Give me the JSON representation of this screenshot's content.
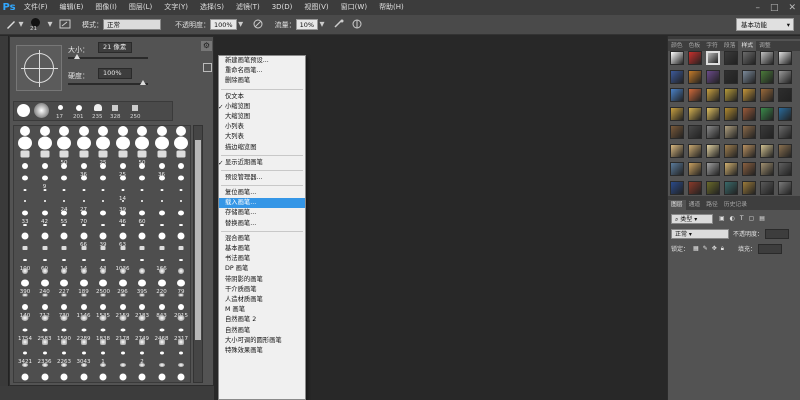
{
  "app": {
    "logo": "Ps",
    "menu": [
      "文件(F)",
      "编辑(E)",
      "图像(I)",
      "图层(L)",
      "文字(Y)",
      "选择(S)",
      "滤镜(T)",
      "3D(D)",
      "视图(V)",
      "窗口(W)",
      "帮助(H)"
    ],
    "window_controls": [
      "–",
      "□",
      "✕"
    ]
  },
  "options_bar": {
    "brush_size_value": "21",
    "mode_label": "模式：",
    "mode_value": "正常",
    "opacity_label": "不透明度：",
    "opacity_value": "100%",
    "flow_label": "流量：",
    "flow_value": "10%",
    "workspace": "基本功能"
  },
  "brush_panel": {
    "size_label": "大小：",
    "size_value": "21 像素",
    "hardness_label": "硬度：",
    "hardness_value": "100%",
    "recent_numbers": [
      "17",
      "201",
      "235",
      "328",
      "250"
    ],
    "grid_numbers": [
      [
        "",
        "",
        "",
        "",
        "",
        "",
        "",
        "",
        ""
      ],
      [
        "",
        "",
        "",
        "",
        "",
        "",
        "",
        "",
        ""
      ],
      [
        "",
        "",
        "50",
        "",
        "25",
        "",
        "50",
        "",
        ""
      ],
      [
        "",
        "",
        "",
        "36",
        "",
        "25",
        "",
        "36",
        ""
      ],
      [
        "",
        "9",
        "",
        "",
        "",
        "",
        "",
        "",
        ""
      ],
      [
        "",
        "",
        "",
        "",
        "",
        "14",
        "",
        "",
        ""
      ],
      [
        "",
        "",
        "24",
        "27",
        "",
        "39",
        "",
        "",
        ""
      ],
      [
        "33",
        "42",
        "55",
        "70",
        "",
        "46",
        "60",
        "",
        ""
      ],
      [
        "",
        "",
        "",
        "",
        "",
        "",
        "",
        "",
        ""
      ],
      [
        "",
        "",
        "",
        "66",
        "39",
        "63",
        "",
        "",
        ""
      ],
      [
        "",
        "",
        "",
        "",
        "",
        "",
        "",
        "",
        ""
      ],
      [
        "100",
        "60",
        "14",
        "14",
        "43",
        "1036",
        "",
        "166",
        ""
      ],
      [
        "",
        "",
        "",
        "",
        "",
        "",
        "",
        "",
        ""
      ],
      [
        "390",
        "240",
        "227",
        "189",
        "2500",
        "296",
        "395",
        "220",
        "79"
      ],
      [
        "",
        "",
        "",
        "",
        "",
        "",
        "",
        "",
        ""
      ],
      [
        "140",
        "712",
        "730",
        "1146",
        "1535",
        "2159",
        "2183",
        "843",
        "2015"
      ],
      [
        "",
        "",
        "",
        "",
        "",
        "",
        "",
        "",
        ""
      ],
      [
        "1754",
        "2583",
        "1590",
        "2289",
        "1838",
        "2178",
        "2749",
        "2468",
        "2317"
      ],
      [
        "",
        "",
        "",
        "",
        "",
        "",
        "",
        "",
        ""
      ],
      [
        "3421",
        "2336",
        "2263",
        "3043",
        "1",
        "",
        "2",
        "",
        ""
      ],
      [
        "",
        "",
        "",
        "",
        "",
        "",
        "",
        "",
        ""
      ],
      [
        "",
        "",
        "",
        "",
        "",
        "",
        "",
        "",
        ""
      ]
    ]
  },
  "context_menu": {
    "sections": [
      [
        "新建画笔预设...",
        "重命名画笔...",
        "删除画笔"
      ],
      [
        "仅文本",
        "小缩览图",
        "大缩览图",
        "小列表",
        "大列表",
        "描边缩览图"
      ],
      [
        "显示近期画笔"
      ],
      [
        "预设管理器..."
      ],
      [
        "复位画笔...",
        "载入画笔...",
        "存储画笔...",
        "替换画笔..."
      ],
      [
        "混合画笔",
        "基本画笔",
        "书法画笔",
        "DP 画笔",
        "带阴影的画笔",
        "干介质画笔",
        "人造材质画笔",
        "M 画笔",
        "自然画笔 2",
        "自然画笔",
        "大小可调的圆形画笔",
        "特殊效果画笔"
      ]
    ],
    "checked": [
      "小缩览图",
      "显示近期画笔"
    ],
    "highlighted": "载入画笔..."
  },
  "right_dock": {
    "top_tabs": [
      "颜色",
      "色板",
      "字符",
      "段落",
      "样式",
      "调整"
    ],
    "active_top_tab": "样式",
    "layer_tabs": [
      "图层",
      "通道",
      "路径",
      "历史记录"
    ],
    "active_layer_tab": "图层",
    "kind_filter": "类型",
    "blend_mode": "正常",
    "opacity_label": "不透明度：",
    "lock_label": "锁定：",
    "fill_label": "填充："
  }
}
